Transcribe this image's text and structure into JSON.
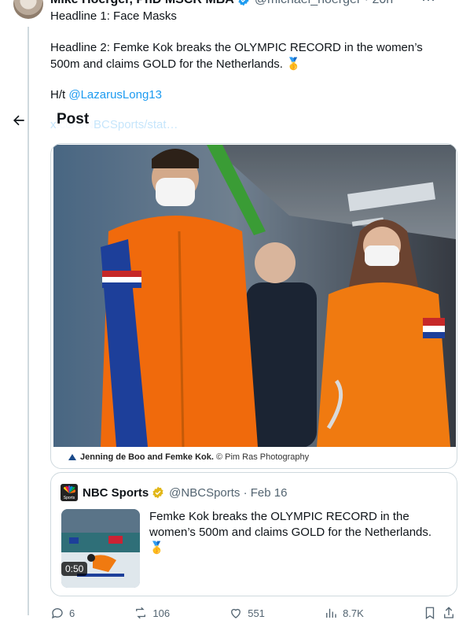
{
  "tweet": {
    "author_name": "Mike Hoerger, PhD MSCR MBA",
    "author_handle": "@michael_hoerger · 20h",
    "line1": "Headline 1: Face Masks",
    "line2": "Headline 2: Femke Kok breaks the OLYMPIC RECORD in the women’s 500m and claims GOLD for the Netherlands. 🥇",
    "hat_tip_prefix": "H/t",
    "hat_tip_link": "@LazarusLong13",
    "url_text": "x.com/NBCSports/stat…"
  },
  "header": {
    "title": "Post"
  },
  "media": {
    "caption_names": "Jenning de Boo and Femke Kok.",
    "caption_credit": "© Pim Ras Photography"
  },
  "quote": {
    "name": "NBC Sports",
    "handle_date": "@NBCSports · Feb 16",
    "text": "Femke Kok breaks the OLYMPIC RECORD in the women’s 500m and claims GOLD for the Netherlands. 🥇",
    "video_duration": "0:50"
  },
  "actions": {
    "replies": "6",
    "reposts": "106",
    "likes": "551",
    "views": "8.7K"
  },
  "colors": {
    "accent": "#1d9bf0",
    "secondary_text": "#536471",
    "border": "#cfd9de"
  }
}
